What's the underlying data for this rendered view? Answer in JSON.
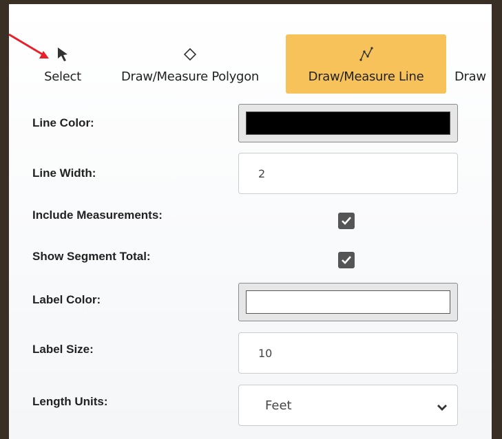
{
  "toolbar": {
    "tools": [
      {
        "label": "Select",
        "icon": "cursor-icon"
      },
      {
        "label": "Draw/Measure Polygon",
        "icon": "polygon-icon"
      },
      {
        "label": "Draw/Measure Line",
        "icon": "polyline-icon",
        "active": true
      },
      {
        "label": "Draw",
        "icon": ""
      }
    ],
    "active_color": "#f7c25a"
  },
  "form": {
    "line_color": {
      "label": "Line Color:",
      "value": "#000000"
    },
    "line_width": {
      "label": "Line Width:",
      "value": "2"
    },
    "include_measurements": {
      "label": "Include Measurements:",
      "checked": true
    },
    "show_segment_total": {
      "label": "Show Segment Total:",
      "checked": true
    },
    "label_color": {
      "label": "Label Color:",
      "value": "#ffffff"
    },
    "label_size": {
      "label": "Label Size:",
      "value": "10"
    },
    "length_units": {
      "label": "Length Units:",
      "value": "Feet"
    }
  },
  "annotation": {
    "color": "#e8202a"
  }
}
